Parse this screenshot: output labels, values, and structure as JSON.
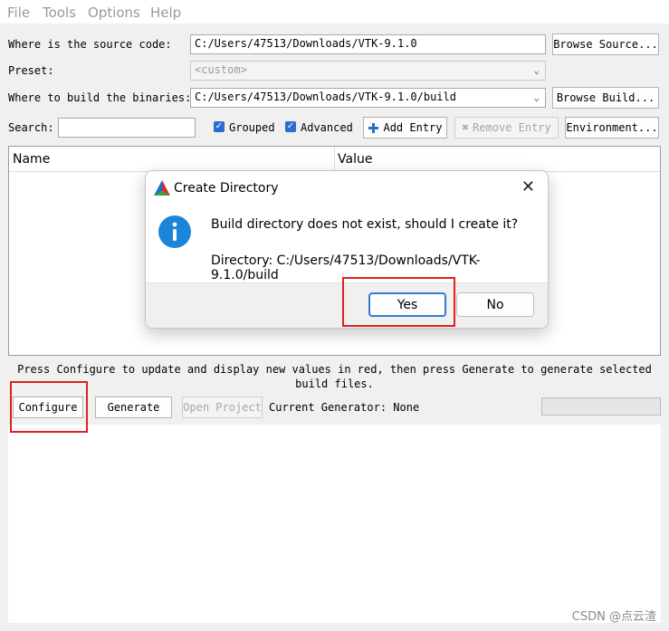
{
  "menu": [
    "File",
    "Tools",
    "Options",
    "Help"
  ],
  "source": {
    "label": "Where is the source code:",
    "value": "C:/Users/47513/Downloads/VTK-9.1.0",
    "browse": "Browse Source..."
  },
  "preset": {
    "label": "Preset:",
    "value": "<custom>"
  },
  "build": {
    "label": "Where to build the binaries:",
    "value": "C:/Users/47513/Downloads/VTK-9.1.0/build",
    "browse": "Browse Build..."
  },
  "toolbar": {
    "search_label": "Search:",
    "search_value": "",
    "grouped_label": "Grouped",
    "grouped_checked": true,
    "advanced_label": "Advanced",
    "advanced_checked": true,
    "add_entry": "Add Entry",
    "remove_entry": "Remove Entry",
    "environment": "Environment..."
  },
  "table": {
    "columns": [
      "Name",
      "Value"
    ]
  },
  "hint": "Press Configure to update and display new values in red, then press Generate to generate selected build files.",
  "actions": {
    "configure": "Configure",
    "generate": "Generate",
    "open_project": "Open Project",
    "current_generator": "Current Generator: None"
  },
  "dialog": {
    "title": "Create Directory",
    "message": "Build directory does not exist, should I create it?",
    "directory": "Directory: C:/Users/47513/Downloads/VTK-9.1.0/build",
    "yes": "Yes",
    "no": "No"
  },
  "watermark": "CSDN @点云渣",
  "colors": {
    "accent": "#2b6ccf",
    "highlight": "#e02020",
    "info_icon": "#1a86d9"
  }
}
